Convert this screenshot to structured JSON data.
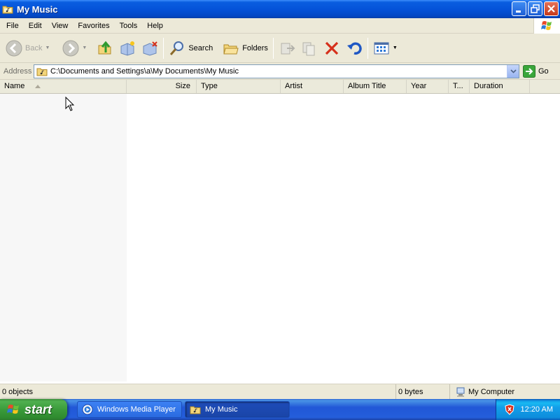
{
  "window": {
    "title": "My Music"
  },
  "menu": {
    "items": [
      "File",
      "Edit",
      "View",
      "Favorites",
      "Tools",
      "Help"
    ]
  },
  "toolbar": {
    "back_label": "Back",
    "search_label": "Search",
    "folders_label": "Folders"
  },
  "address": {
    "label": "Address",
    "value": "C:\\Documents and Settings\\a\\My Documents\\My Music",
    "go_label": "Go"
  },
  "columns": {
    "name": "Name",
    "size": "Size",
    "type": "Type",
    "artist": "Artist",
    "album_title": "Album Title",
    "year": "Year",
    "track": "T...",
    "duration": "Duration"
  },
  "status": {
    "objects": "0 objects",
    "bytes": "0 bytes",
    "location": "My Computer"
  },
  "taskbar": {
    "start_label": "start",
    "tasks": [
      "Windows Media Player",
      "My Music"
    ],
    "clock": "12:20 AM"
  },
  "colors": {
    "titlebar_blue": "#0553d9",
    "chrome": "#ece9d8",
    "start_green": "#3b9b3b",
    "tray_blue": "#139ee9"
  }
}
